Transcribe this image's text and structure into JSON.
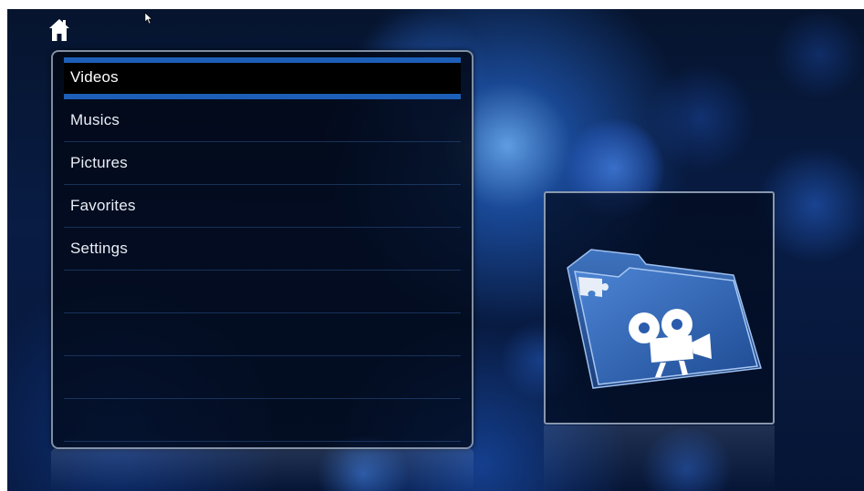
{
  "menu": {
    "items": [
      {
        "label": "Videos",
        "selected": true
      },
      {
        "label": "Musics",
        "selected": false
      },
      {
        "label": "Pictures",
        "selected": false
      },
      {
        "label": "Favorites",
        "selected": false
      },
      {
        "label": "Settings",
        "selected": false
      }
    ]
  },
  "icons": {
    "home": "home-icon",
    "cursor": "mouse-pointer-icon",
    "preview": "video-addon-folder-icon"
  },
  "colors": {
    "selection_bar": "#1d5fb8",
    "text": "#e9eef6",
    "background": "#081c44"
  }
}
